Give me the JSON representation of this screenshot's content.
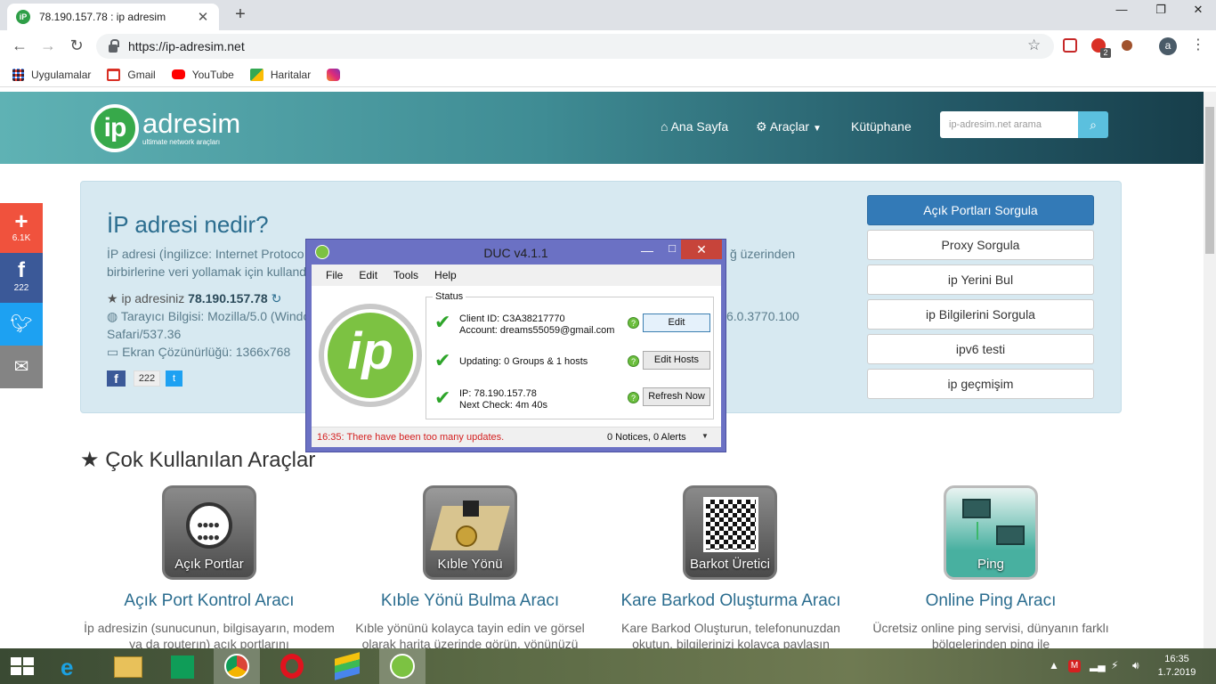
{
  "browser": {
    "tab_title": "78.190.157.78 : ip adresim",
    "favicon_text": "iP",
    "url": "https://ip-adresim.net",
    "profile_initial": "a",
    "ext_badge": "2",
    "bookmarks": [
      {
        "label": "Uygulamalar",
        "icon": "apps-grid-icon"
      },
      {
        "label": "Gmail",
        "icon": "gmail-icon"
      },
      {
        "label": "YouTube",
        "icon": "youtube-icon"
      },
      {
        "label": "Haritalar",
        "icon": "maps-icon"
      },
      {
        "label": "",
        "icon": "instagram-icon"
      }
    ]
  },
  "site": {
    "logo_mark": "ip",
    "logo_word": "adresim",
    "logo_tagline": "ultimate network araçları",
    "nav": {
      "home": "Ana Sayfa",
      "tools": "Araçlar",
      "library": "Kütüphane"
    },
    "search_placeholder": "ip-adresim.net arama",
    "info": {
      "heading": "İP adresi nedir?",
      "desc1_left": "İP adresi (İngilizce: Internet Protoco",
      "desc1_right": "ğ üzerinden",
      "desc2_left": "birbirlerine veri yollamak için kulland",
      "ip_label": "ip adresiniz",
      "ip_value": "78.190.157.78",
      "browser_left": "Tarayıcı Bilgisi: Mozilla/5.0 (Windo",
      "browser_right": "6.0.3770.100",
      "browser_line2": "Safari/537.36",
      "screen": "Ekran Çözünürlüğü: 1366x768",
      "share_count": "222"
    },
    "right_buttons": [
      "Açık Portları Sorgula",
      "Proxy Sorgula",
      "ip Yerini Bul",
      "ip Bilgilerini Sorgula",
      "ipv6 testi",
      "ip geçmişim"
    ],
    "tools_heading": "Çok Kullanılan Araçlar",
    "tools": [
      {
        "icon_label": "Açık Portlar",
        "title": "Açık Port Kontrol Aracı",
        "desc": "İp adresizin (sunucunun, bilgisayarın, modem ya da routerın) açık portlarını"
      },
      {
        "icon_label": "Kıble Yönü",
        "title": "Kıble Yönü Bulma Aracı",
        "desc": "Kıble yönünü kolayca tayin edin ve görsel olarak harita üzerinde görün, yönünüzü"
      },
      {
        "icon_label": "Barkot Üretici",
        "title": "Kare Barkod Oluşturma Aracı",
        "desc": "Kare Barkod Oluşturun, telefonunuzdan okutun, bilgilerinizi kolayca paylaşın"
      },
      {
        "icon_label": "Ping",
        "title": "Online Ping Aracı",
        "desc": "Ücretsiz online ping servisi, dünyanın farklı bölgelerinden ping ile"
      }
    ]
  },
  "social": {
    "plus_count": "6.1K",
    "fb_count": "222"
  },
  "duc": {
    "title": "DUC v4.1.1",
    "menu": [
      "File",
      "Edit",
      "Tools",
      "Help"
    ],
    "status_label": "Status",
    "logo_text": "ip",
    "client_id": "Client ID: C3A38217770",
    "account": "Account: dreams55059@gmail.com",
    "updating": "Updating: 0 Groups & 1 hosts",
    "ip": "IP: 78.190.157.78",
    "next_check": "Next Check: 4m 40s",
    "btn_edit": "Edit",
    "btn_edit_hosts": "Edit Hosts",
    "btn_refresh": "Refresh Now",
    "status_msg": "16:35: There have been too many updates.",
    "notices": "0 Notices, 0 Alerts"
  },
  "taskbar": {
    "time": "16:35",
    "date": "1.7.2019"
  },
  "colors": {
    "accent": "#2b6d8f",
    "primary_btn": "#337ab7",
    "header_start": "#5fb2b4",
    "header_end": "#173e4a",
    "duc_frame": "#6b71c4"
  }
}
